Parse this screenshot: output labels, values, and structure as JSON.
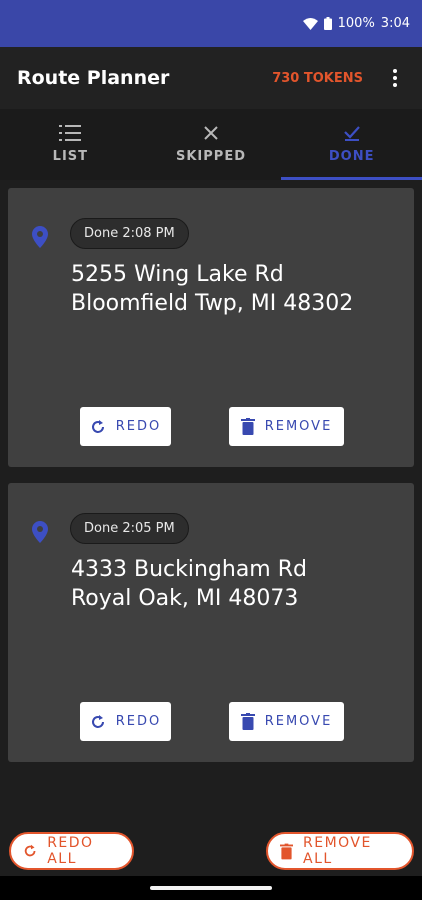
{
  "status_bar": {
    "battery": "100%",
    "time": "3:04"
  },
  "app_bar": {
    "title": "Route Planner",
    "tokens": "730 TOKENS",
    "menu_icon": "more-vert-icon"
  },
  "tabs": [
    {
      "label": "LIST",
      "icon": "list-icon",
      "active": false
    },
    {
      "label": "SKIPPED",
      "icon": "close-icon",
      "active": false
    },
    {
      "label": "DONE",
      "icon": "check-icon",
      "active": true
    }
  ],
  "cards": [
    {
      "status": "Done 2:08 PM",
      "address_line1": "5255 Wing Lake Rd",
      "address_line2": "Bloomfield Twp, MI 48302",
      "redo_label": "REDO",
      "remove_label": "REMOVE"
    },
    {
      "status": "Done 2:05 PM",
      "address_line1": "4333 Buckingham Rd",
      "address_line2": "Royal Oak, MI 48073",
      "redo_label": "REDO",
      "remove_label": "REMOVE"
    }
  ],
  "footer": {
    "redo_all_label": "REDO ALL",
    "remove_all_label": "REMOVE ALL"
  },
  "colors": {
    "primary": "#3d4fc4",
    "accent": "#e2552c",
    "status_bar": "#3a47a8",
    "card": "#404040"
  }
}
